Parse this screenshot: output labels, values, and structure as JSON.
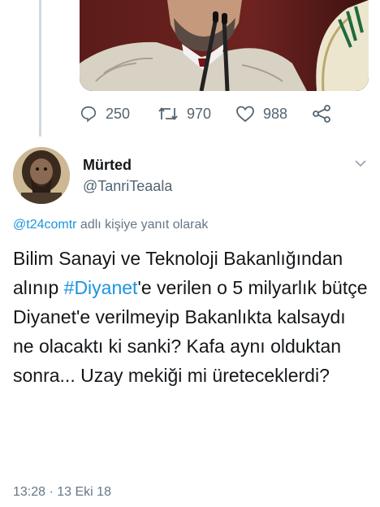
{
  "quoted_tweet": {
    "stats": {
      "replies": "250",
      "retweets": "970",
      "likes": "988"
    }
  },
  "tweet": {
    "author_name": "Mürted",
    "author_handle": "@TanriTeaala",
    "reply_mention": "@t24comtr",
    "reply_suffix": " adlı kişiye yanıt olarak",
    "text_before_hashtag": "Bilim Sanayi ve Teknoloji Bakanlığından alınıp ",
    "hashtag": "#Diyanet",
    "text_after_hashtag": "'e verilen o 5 milyarlık bütçe Diyanet'e verilmeyip Bakanlıkta kalsaydı ne olacaktı ki sanki? Kafa aynı olduktan sonra... Uzay mekiği mi üreteceklerdi?",
    "timestamp": "13:28 · 13 Eki 18"
  },
  "colors": {
    "link": "#1b95e0",
    "secondary_text": "#657786",
    "icon": "#536471"
  }
}
